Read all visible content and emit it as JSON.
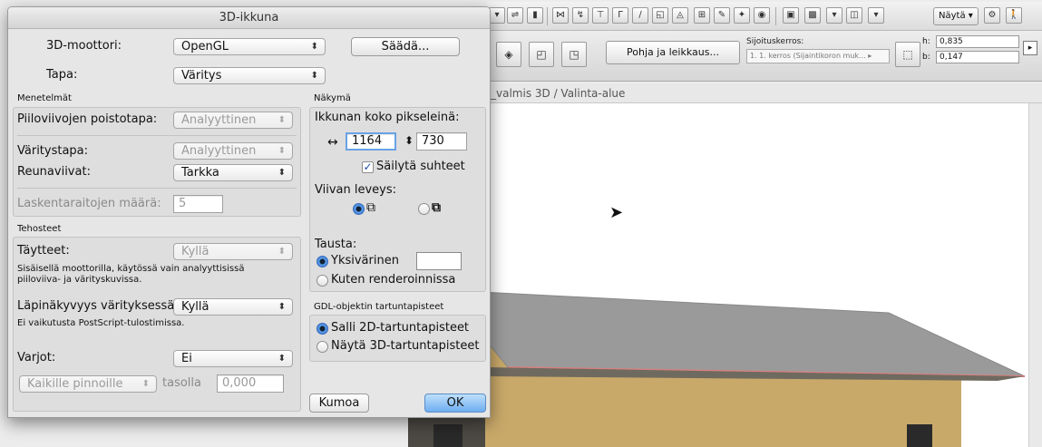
{
  "background": {
    "view_title": "_valmis 3D / Valinta-alue",
    "toolbar": {
      "naytta_label": "Näytä ▾",
      "pohja_label": "Pohja ja leikkaus...",
      "placement_label": "Sijoituskerros:",
      "placement_value": "1. 1. kerros (Sijaintikoron muk... ▸",
      "h_label": "h:",
      "h_value": "0,835",
      "b_label": "b:",
      "b_value": "0,147"
    },
    "colors": {
      "roof": "#9a9a9a",
      "wall": "#c9a96a",
      "roof_edge": "#d98080"
    }
  },
  "dialog": {
    "title": "3D-ikkuna",
    "engine_label": "3D-moottori:",
    "engine_value": "OpenGL",
    "adjust_button": "Säädä...",
    "mode_label": "Tapa:",
    "mode_value": "Väritys",
    "methods": {
      "header": "Menetelmät",
      "hidden_line_label": "Piiloviivojen poistotapa:",
      "hidden_line_value": "Analyyttinen",
      "shading_label": "Väritystapa:",
      "shading_value": "Analyyttinen",
      "edges_label": "Reunaviivat:",
      "edges_value": "Tarkka",
      "strips_label": "Laskentaraitojen määrä:",
      "strips_value": "5"
    },
    "effects": {
      "header": "Tehosteet",
      "fills_label": "Täytteet:",
      "fills_value": "Kyllä",
      "fills_note": "Sisäisellä moottorilla, käytössä vain analyyttisissä piiloviiva- ja värityskuvissa.",
      "transparency_label": "Läpinäkyvyys värityksessä:",
      "transparency_value": "Kyllä",
      "transparency_note": "Ei vaikutusta PostScript-tulostimissa.",
      "shadows_label": "Varjot:",
      "shadows_value": "Ei",
      "surfaces_value": "Kaikille pinnoille",
      "level_label": "tasolla",
      "level_value": "0,000"
    },
    "view": {
      "header": "Näkymä",
      "window_size_label": "Ikkunan koko pikseleinä:",
      "width_value": "1164",
      "height_value": "730",
      "keep_ratio_label": "Säilytä suhteet",
      "line_width_label": "Viivan leveys:",
      "background_label": "Tausta:",
      "mono_label": "Yksivärinen",
      "render_label": "Kuten renderoinnissa"
    },
    "gdl": {
      "header": "GDL-objektin tartuntapisteet",
      "allow_2d_label": "Salli 2D-tartuntapisteet",
      "show_3d_label": "Näytä 3D-tartuntapisteet"
    },
    "cancel_button": "Kumoa",
    "ok_button": "OK"
  }
}
